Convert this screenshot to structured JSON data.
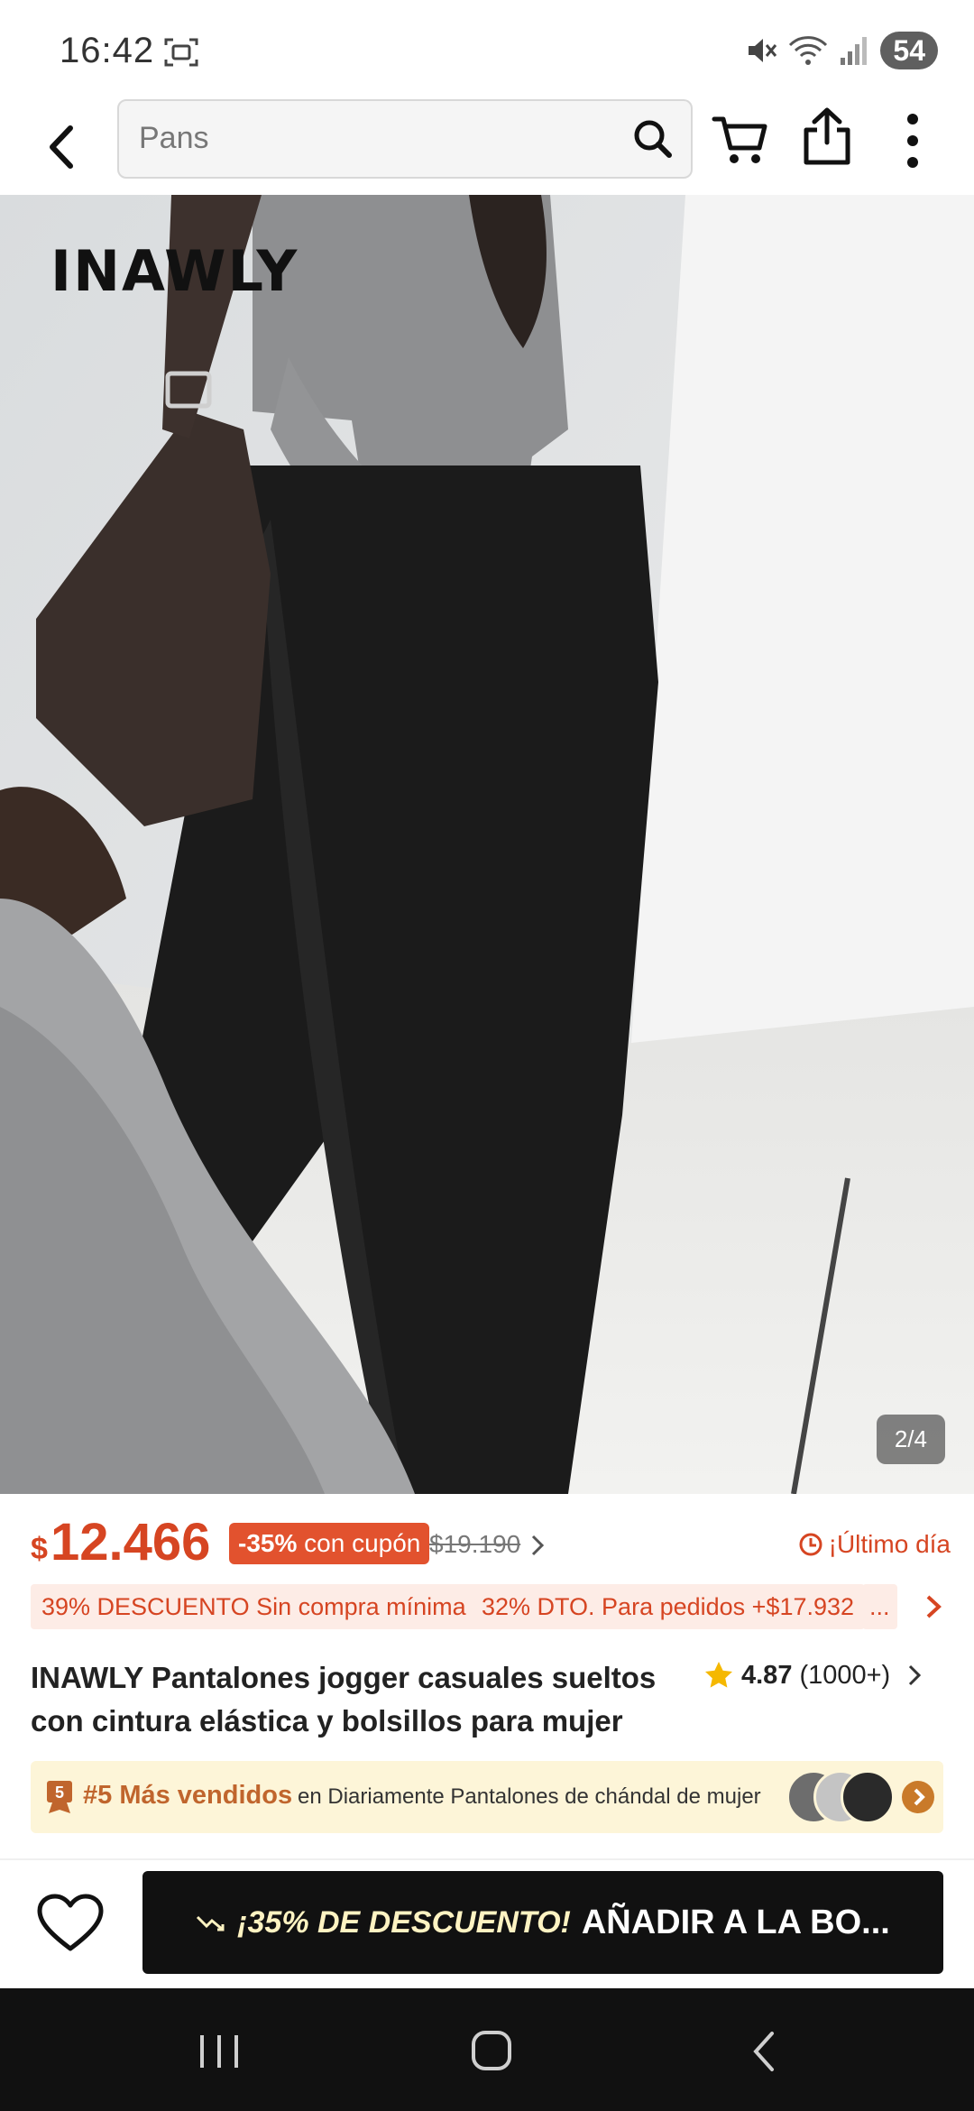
{
  "status_bar": {
    "time": "16:42",
    "battery": "54"
  },
  "app_bar": {
    "search_value": "Pans"
  },
  "hero": {
    "brand_overlay": "INAWLY",
    "image_counter": "2/4"
  },
  "price": {
    "currency": "$",
    "current": "12.466",
    "discount_badge_bold": "-35%",
    "discount_badge_text": "con cupón",
    "original": "$19.190",
    "timer_label": "¡Último día"
  },
  "coupons": [
    "39% DESCUENTO Sin compra mínima",
    "32% DTO. Para pedidos +$17.932",
    "..."
  ],
  "product": {
    "title": "INAWLY Pantalones jogger casuales sueltos con cintura elástica y bolsillos para mujer",
    "rating": "4.87",
    "reviews": "(1000+)"
  },
  "best_seller": {
    "rank": "#5 Más vendidos",
    "category": "en Diariamente Pantalones de chándal de mujer"
  },
  "action_bar": {
    "promo": "¡35% DE DESCUENTO!",
    "button": "AÑADIR A LA BO..."
  },
  "colors": {
    "accent": "#d64522",
    "badge": "#e2522e",
    "chip_bg": "#fdece6",
    "bestseller_bg": "#fdf5d8",
    "button_bg": "#111111"
  }
}
